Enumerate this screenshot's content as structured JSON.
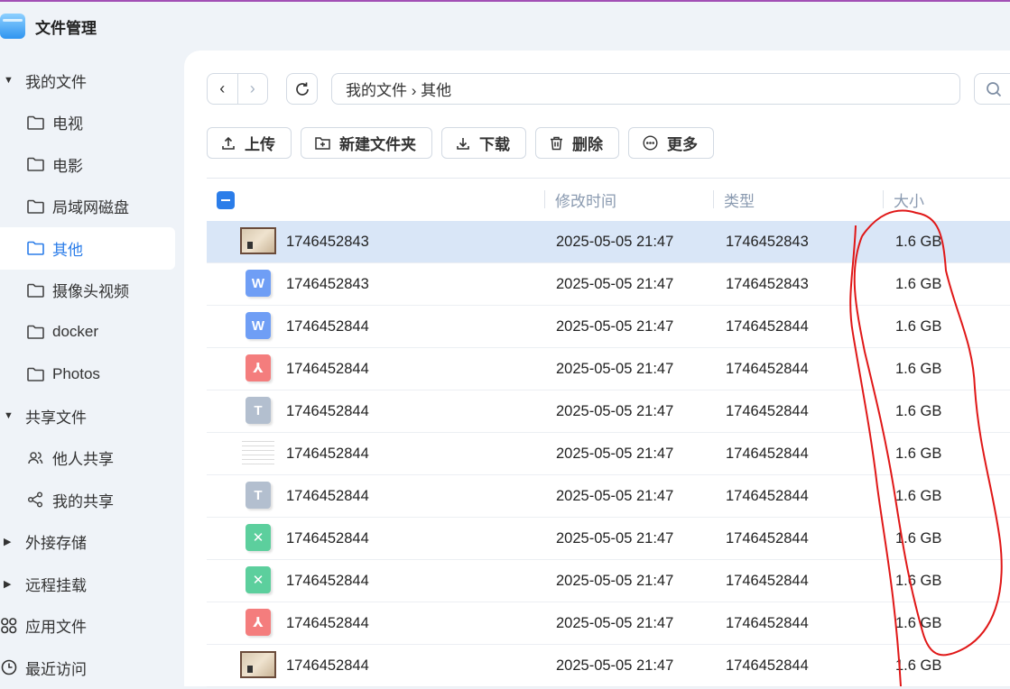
{
  "app": {
    "title": "文件管理"
  },
  "sidebar": {
    "my_files": "我的文件",
    "folders": [
      "电视",
      "电影",
      "局域网磁盘",
      "其他",
      "摄像头视频",
      "docker",
      "Photos"
    ],
    "shared": "共享文件",
    "shared_items": [
      "他人共享",
      "我的共享"
    ],
    "external": "外接存储",
    "remote": "远程挂载",
    "apps": "应用文件",
    "recent": "最近访问"
  },
  "toolbar": {
    "path": "我的文件 › 其他",
    "buttons": [
      "上传",
      "新建文件夹",
      "下载",
      "删除",
      "更多"
    ]
  },
  "table": {
    "headers": [
      "修改时间",
      "类型",
      "大小"
    ],
    "rows": [
      {
        "icon": "image",
        "name": "1746452843",
        "time": "2025-05-05 21:47",
        "type": "1746452843",
        "size": "1.6 GB"
      },
      {
        "icon": "word",
        "name": "1746452843",
        "time": "2025-05-05 21:47",
        "type": "1746452843",
        "size": "1.6 GB"
      },
      {
        "icon": "word",
        "name": "1746452844",
        "time": "2025-05-05 21:47",
        "type": "1746452844",
        "size": "1.6 GB"
      },
      {
        "icon": "pdf",
        "name": "1746452844",
        "time": "2025-05-05 21:47",
        "type": "1746452844",
        "size": "1.6 GB"
      },
      {
        "icon": "text",
        "name": "1746452844",
        "time": "2025-05-05 21:47",
        "type": "1746452844",
        "size": "1.6 GB"
      },
      {
        "icon": "doc-image",
        "name": "1746452844",
        "time": "2025-05-05 21:47",
        "type": "1746452844",
        "size": "1.6 GB"
      },
      {
        "icon": "text",
        "name": "1746452844",
        "time": "2025-05-05 21:47",
        "type": "1746452844",
        "size": "1.6 GB"
      },
      {
        "icon": "excel",
        "name": "1746452844",
        "time": "2025-05-05 21:47",
        "type": "1746452844",
        "size": "1.6 GB"
      },
      {
        "icon": "excel",
        "name": "1746452844",
        "time": "2025-05-05 21:47",
        "type": "1746452844",
        "size": "1.6 GB"
      },
      {
        "icon": "pdf",
        "name": "1746452844",
        "time": "2025-05-05 21:47",
        "type": "1746452844",
        "size": "1.6 GB"
      },
      {
        "icon": "image",
        "name": "1746452844",
        "time": "2025-05-05 21:47",
        "type": "1746452844",
        "size": "1.6 GB"
      }
    ]
  },
  "colors": {
    "accent": "#2b7de9",
    "selected_row": "#d9e6f7",
    "annotation": "#e01818",
    "word": "#6f9ef5",
    "pdf": "#f47d7d",
    "text": "#b3bfcf",
    "excel": "#5ccf9d"
  }
}
